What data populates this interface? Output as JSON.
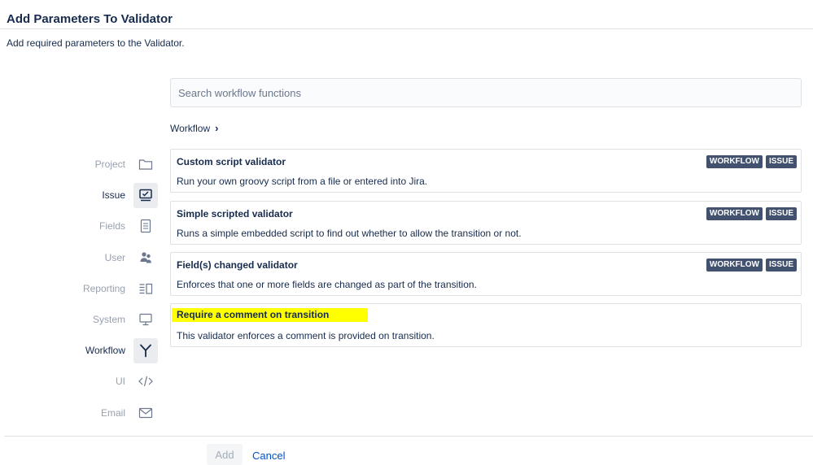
{
  "header": {
    "title": "Add Parameters To Validator",
    "description": "Add required parameters to the Validator."
  },
  "search": {
    "placeholder": "Search workflow functions",
    "value": ""
  },
  "breadcrumb": {
    "label": "Workflow",
    "icon": "chevron-right-icon"
  },
  "categories": [
    {
      "label": "Project",
      "icon": "folder-icon",
      "active": false
    },
    {
      "label": "Issue",
      "icon": "issue-icon",
      "active": true
    },
    {
      "label": "Fields",
      "icon": "document-icon",
      "active": false
    },
    {
      "label": "User",
      "icon": "users-icon",
      "active": false
    },
    {
      "label": "Reporting",
      "icon": "reporting-icon",
      "active": false
    },
    {
      "label": "System",
      "icon": "monitor-icon",
      "active": false
    },
    {
      "label": "Workflow",
      "icon": "workflow-branch-icon",
      "active": true
    },
    {
      "label": "UI",
      "icon": "code-icon",
      "active": false
    },
    {
      "label": "Email",
      "icon": "envelope-icon",
      "active": false
    }
  ],
  "functions": [
    {
      "name": "Custom script validator",
      "description": "Run your own groovy script from a file or entered into Jira.",
      "badges": [
        "WORKFLOW",
        "ISSUE"
      ]
    },
    {
      "name": "Simple scripted validator",
      "description": "Runs a simple embedded script to find out whether to allow the transition or not.",
      "badges": [
        "WORKFLOW",
        "ISSUE"
      ]
    },
    {
      "name": "Field(s) changed validator",
      "description": "Enforces that one or more fields are changed as part of the transition.",
      "badges": [
        "WORKFLOW",
        "ISSUE"
      ]
    },
    {
      "name": "Require a comment on transition",
      "description": "This validator enforces a comment is provided on transition.",
      "badges": [],
      "highlighted": true
    }
  ],
  "footer": {
    "add_label": "Add",
    "cancel_label": "Cancel"
  },
  "colors": {
    "badge_bg": "#42526e",
    "highlight": "#ffff00",
    "link": "#0052cc"
  }
}
